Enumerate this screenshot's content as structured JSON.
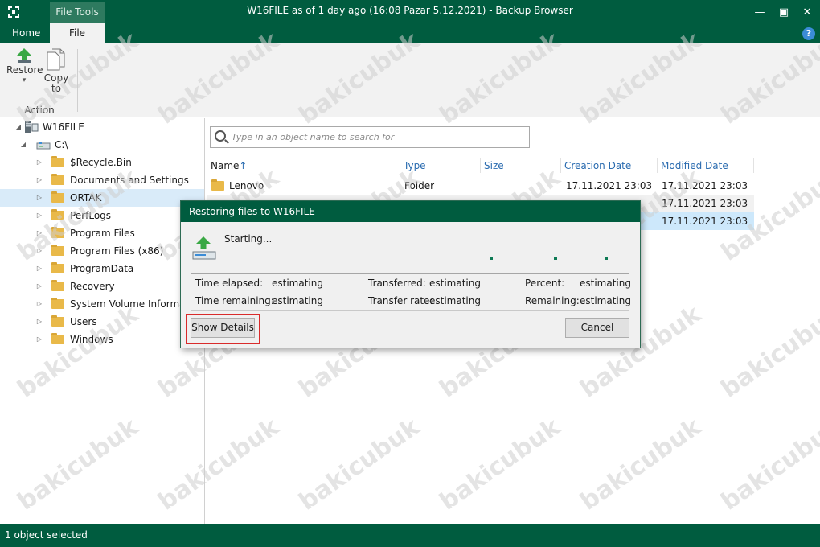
{
  "window": {
    "title": "W16FILE as of 1 day ago (16:08 Pazar 5.12.2021) - Backup Browser",
    "context_tab": "File Tools",
    "minimize_glyph": "—",
    "maximize_glyph": "▣",
    "close_glyph": "✕",
    "help_glyph": "?"
  },
  "ribbon": {
    "tabs": [
      {
        "label": "Home",
        "active": false
      },
      {
        "label": "File",
        "active": true
      }
    ],
    "restore_label": "Restore",
    "restore_arrow": "▾",
    "copy_label_1": "Copy",
    "copy_label_2": "to",
    "group_label": "Action"
  },
  "tree": {
    "root": "W16FILE",
    "drive": "C:\\",
    "folders": [
      "$Recycle.Bin",
      "Documents and Settings",
      "ORTAK",
      "PerfLogs",
      "Program Files",
      "Program Files (x86)",
      "ProgramData",
      "Recovery",
      "System Volume Information",
      "Users",
      "Windows"
    ],
    "selected": "ORTAK"
  },
  "search": {
    "placeholder": "Type in an object name to search for"
  },
  "table": {
    "columns": [
      "Name",
      "Type",
      "Size",
      "Creation Date",
      "Modified Date"
    ],
    "sort_indicator": "↑",
    "rows": [
      {
        "name": "Lenovo",
        "type": "Folder",
        "size": "",
        "created": "17.11.2021 23:03",
        "modified": "17.11.2021 23:03"
      },
      {
        "name": "",
        "type": "",
        "size": "",
        "created": "",
        "modified": "17.11.2021 23:03"
      },
      {
        "name": "",
        "type": "",
        "size": "",
        "created": "",
        "modified": "17.11.2021 23:03"
      }
    ]
  },
  "dialog": {
    "title": "Restoring files to W16FILE",
    "status": "Starting...",
    "time_elapsed_label": "Time elapsed:",
    "time_elapsed_value": "estimating",
    "time_remaining_label": "Time remaining:",
    "time_remaining_value": "estimating",
    "transferred_label": "Transferred:",
    "transferred_value": "estimating",
    "transfer_rate_label": "Transfer rate:",
    "transfer_rate_value": "estimating",
    "percent_label": "Percent:",
    "percent_value": "estimating",
    "remaining_label": "Remaining:",
    "remaining_value": "estimating",
    "show_details_label": "Show Details",
    "cancel_label": "Cancel"
  },
  "status_bar": {
    "text": "1 object selected"
  },
  "watermark": "bakicubuk",
  "colors": {
    "brand_green": "#005c3f",
    "highlight_red": "#d92b2b",
    "link_blue": "#2b6cb0",
    "selection_blue": "#cde8fb"
  }
}
